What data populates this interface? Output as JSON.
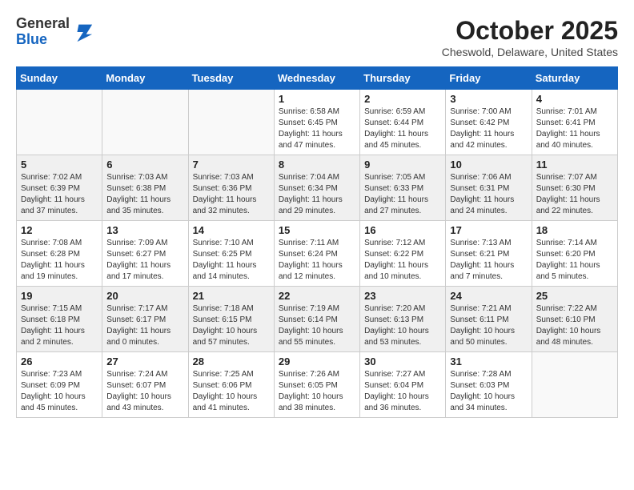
{
  "header": {
    "logo_general": "General",
    "logo_blue": "Blue",
    "calendar_title": "October 2025",
    "calendar_subtitle": "Cheswold, Delaware, United States"
  },
  "weekdays": [
    "Sunday",
    "Monday",
    "Tuesday",
    "Wednesday",
    "Thursday",
    "Friday",
    "Saturday"
  ],
  "weeks": [
    [
      {
        "day": "",
        "info": ""
      },
      {
        "day": "",
        "info": ""
      },
      {
        "day": "",
        "info": ""
      },
      {
        "day": "1",
        "info": "Sunrise: 6:58 AM\nSunset: 6:45 PM\nDaylight: 11 hours\nand 47 minutes."
      },
      {
        "day": "2",
        "info": "Sunrise: 6:59 AM\nSunset: 6:44 PM\nDaylight: 11 hours\nand 45 minutes."
      },
      {
        "day": "3",
        "info": "Sunrise: 7:00 AM\nSunset: 6:42 PM\nDaylight: 11 hours\nand 42 minutes."
      },
      {
        "day": "4",
        "info": "Sunrise: 7:01 AM\nSunset: 6:41 PM\nDaylight: 11 hours\nand 40 minutes."
      }
    ],
    [
      {
        "day": "5",
        "info": "Sunrise: 7:02 AM\nSunset: 6:39 PM\nDaylight: 11 hours\nand 37 minutes."
      },
      {
        "day": "6",
        "info": "Sunrise: 7:03 AM\nSunset: 6:38 PM\nDaylight: 11 hours\nand 35 minutes."
      },
      {
        "day": "7",
        "info": "Sunrise: 7:03 AM\nSunset: 6:36 PM\nDaylight: 11 hours\nand 32 minutes."
      },
      {
        "day": "8",
        "info": "Sunrise: 7:04 AM\nSunset: 6:34 PM\nDaylight: 11 hours\nand 29 minutes."
      },
      {
        "day": "9",
        "info": "Sunrise: 7:05 AM\nSunset: 6:33 PM\nDaylight: 11 hours\nand 27 minutes."
      },
      {
        "day": "10",
        "info": "Sunrise: 7:06 AM\nSunset: 6:31 PM\nDaylight: 11 hours\nand 24 minutes."
      },
      {
        "day": "11",
        "info": "Sunrise: 7:07 AM\nSunset: 6:30 PM\nDaylight: 11 hours\nand 22 minutes."
      }
    ],
    [
      {
        "day": "12",
        "info": "Sunrise: 7:08 AM\nSunset: 6:28 PM\nDaylight: 11 hours\nand 19 minutes."
      },
      {
        "day": "13",
        "info": "Sunrise: 7:09 AM\nSunset: 6:27 PM\nDaylight: 11 hours\nand 17 minutes."
      },
      {
        "day": "14",
        "info": "Sunrise: 7:10 AM\nSunset: 6:25 PM\nDaylight: 11 hours\nand 14 minutes."
      },
      {
        "day": "15",
        "info": "Sunrise: 7:11 AM\nSunset: 6:24 PM\nDaylight: 11 hours\nand 12 minutes."
      },
      {
        "day": "16",
        "info": "Sunrise: 7:12 AM\nSunset: 6:22 PM\nDaylight: 11 hours\nand 10 minutes."
      },
      {
        "day": "17",
        "info": "Sunrise: 7:13 AM\nSunset: 6:21 PM\nDaylight: 11 hours\nand 7 minutes."
      },
      {
        "day": "18",
        "info": "Sunrise: 7:14 AM\nSunset: 6:20 PM\nDaylight: 11 hours\nand 5 minutes."
      }
    ],
    [
      {
        "day": "19",
        "info": "Sunrise: 7:15 AM\nSunset: 6:18 PM\nDaylight: 11 hours\nand 2 minutes."
      },
      {
        "day": "20",
        "info": "Sunrise: 7:17 AM\nSunset: 6:17 PM\nDaylight: 11 hours\nand 0 minutes."
      },
      {
        "day": "21",
        "info": "Sunrise: 7:18 AM\nSunset: 6:15 PM\nDaylight: 10 hours\nand 57 minutes."
      },
      {
        "day": "22",
        "info": "Sunrise: 7:19 AM\nSunset: 6:14 PM\nDaylight: 10 hours\nand 55 minutes."
      },
      {
        "day": "23",
        "info": "Sunrise: 7:20 AM\nSunset: 6:13 PM\nDaylight: 10 hours\nand 53 minutes."
      },
      {
        "day": "24",
        "info": "Sunrise: 7:21 AM\nSunset: 6:11 PM\nDaylight: 10 hours\nand 50 minutes."
      },
      {
        "day": "25",
        "info": "Sunrise: 7:22 AM\nSunset: 6:10 PM\nDaylight: 10 hours\nand 48 minutes."
      }
    ],
    [
      {
        "day": "26",
        "info": "Sunrise: 7:23 AM\nSunset: 6:09 PM\nDaylight: 10 hours\nand 45 minutes."
      },
      {
        "day": "27",
        "info": "Sunrise: 7:24 AM\nSunset: 6:07 PM\nDaylight: 10 hours\nand 43 minutes."
      },
      {
        "day": "28",
        "info": "Sunrise: 7:25 AM\nSunset: 6:06 PM\nDaylight: 10 hours\nand 41 minutes."
      },
      {
        "day": "29",
        "info": "Sunrise: 7:26 AM\nSunset: 6:05 PM\nDaylight: 10 hours\nand 38 minutes."
      },
      {
        "day": "30",
        "info": "Sunrise: 7:27 AM\nSunset: 6:04 PM\nDaylight: 10 hours\nand 36 minutes."
      },
      {
        "day": "31",
        "info": "Sunrise: 7:28 AM\nSunset: 6:03 PM\nDaylight: 10 hours\nand 34 minutes."
      },
      {
        "day": "",
        "info": ""
      }
    ]
  ]
}
